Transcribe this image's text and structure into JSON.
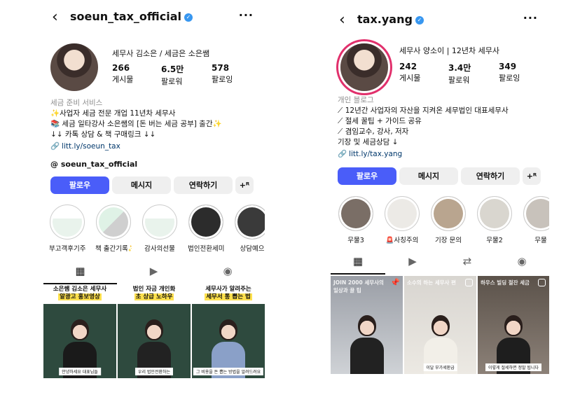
{
  "left": {
    "username": "soeun_tax_official",
    "full_name": "세무사 김소은 / 세금은 소은쌤",
    "stats": [
      {
        "num": "266",
        "label": "게시물"
      },
      {
        "num": "6.5만",
        "label": "팔로워"
      },
      {
        "num": "578",
        "label": "팔로잉"
      }
    ],
    "category": "세금 준비 서비스",
    "bio_lines": [
      "✨사업자 세금 전문 개업 11년차 세무사",
      "📚 세금 일타강사 소은쌤의 [돈 버는 세금 공부] 출간✨",
      "↓↓ 카톡 상담 & 책 구매링크 ↓↓"
    ],
    "link": "litt.ly/soeun_tax",
    "threads": "soeun_tax_official",
    "buttons": {
      "follow": "팔로우",
      "message": "메시지",
      "contact": "연락하기",
      "add": "+ᴿ"
    },
    "highlights": [
      "부고객후기주",
      "책 출간기록✨",
      "감사의선물",
      "법인전환세미...",
      "상담예으"
    ],
    "tiles": [
      {
        "line1": "소은쌤 김소은 세무사",
        "line2": "알광고 홍보영상",
        "caption": "안녕하세요 대표님들"
      },
      {
        "line1": "법인 자금 개인화",
        "line2": "초 상급 노하우",
        "caption": "우리 법인전환하는"
      },
      {
        "line1": "세무사가 알려주는",
        "line2": "세무서 통 뽑는 법",
        "caption": "그 비용을 돈 뽑는 방법을 알려드려요"
      }
    ]
  },
  "right": {
    "username": "tax.yang",
    "full_name": "세무사 양소이 | 12년차 세무사",
    "stats": [
      {
        "num": "242",
        "label": "게시물"
      },
      {
        "num": "3.4만",
        "label": "팔로워"
      },
      {
        "num": "349",
        "label": "팔로잉"
      }
    ],
    "category": "개인 블로그",
    "bio_lines": [
      "12년간 사업자의 자산을 지켜온 세무법인 대표세무사",
      "절세 꿀팁 + 가이드 공유",
      "겸임교수, 강사, 저자",
      "기장 및 세금상담 ↓"
    ],
    "link": "litt.ly/tax.yang",
    "buttons": {
      "follow": "팔로우",
      "message": "메시지",
      "contact": "연락하기",
      "add": "+ᴿ"
    },
    "highlights": [
      "무물3",
      "🚨사칭주의",
      "기장 문의",
      "무물2",
      "무물"
    ],
    "tiles": [
      {
        "overlay": "JOIN 2000 세무사의 일상과 꿀 팁",
        "caption": ""
      },
      {
        "overlay": "소수의 하는 세무사 편",
        "caption": "이달 부가세환급"
      },
      {
        "overlay": "하우스 빌딩 절잔 세금",
        "caption": "이렇게 절세하면 정말 됩니다"
      }
    ]
  },
  "colors": {
    "primary": "#4a5df9",
    "verified": "#3897f0",
    "link": "#00376b",
    "ring": "#e1306c"
  }
}
